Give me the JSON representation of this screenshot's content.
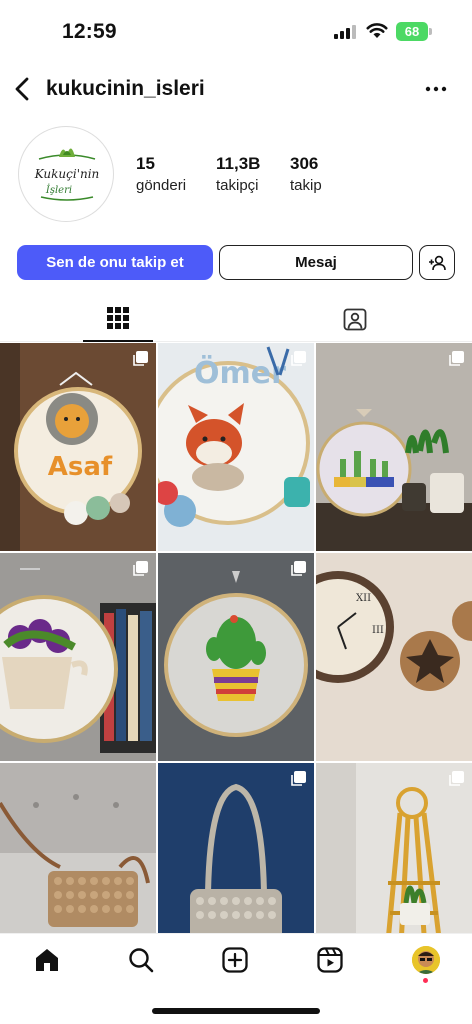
{
  "status_bar": {
    "time": "12:59",
    "battery": "68"
  },
  "header": {
    "username": "kukucinin_isleri"
  },
  "profile": {
    "logo_text_line1": "Kukuçi'nin",
    "logo_text_line2": "İşleri",
    "stats": [
      {
        "value": "15",
        "label": "gönderi"
      },
      {
        "value": "11,3B",
        "label": "takipçi"
      },
      {
        "value": "306",
        "label": "takip"
      }
    ]
  },
  "actions": {
    "follow_label": "Sen de onu takip et",
    "message_label": "Mesaj"
  },
  "posts": [
    {
      "subject": "embroidery-hoop-lion",
      "art_text": "Asaf",
      "multi": true
    },
    {
      "subject": "embroidery-hoop-fox",
      "art_text": "Ömer",
      "multi": true
    },
    {
      "subject": "embroidery-hoop-cacti",
      "multi": true
    },
    {
      "subject": "embroidery-hoop-flower-pot",
      "multi": true
    },
    {
      "subject": "embroidery-hoop-cactus",
      "multi": true
    },
    {
      "subject": "wall-clock-decor",
      "multi": false
    },
    {
      "subject": "knitted-bag-beige",
      "multi": false
    },
    {
      "subject": "knitted-bag-grey",
      "multi": true
    },
    {
      "subject": "macrame-plant-hanger",
      "multi": true
    }
  ],
  "colors": {
    "accent": "#4d5bf9",
    "battery": "#4cd964",
    "notification": "#ff2d55"
  },
  "bottom_nav": [
    "home-icon",
    "search-icon",
    "create-icon",
    "reels-icon",
    "profile-avatar"
  ]
}
